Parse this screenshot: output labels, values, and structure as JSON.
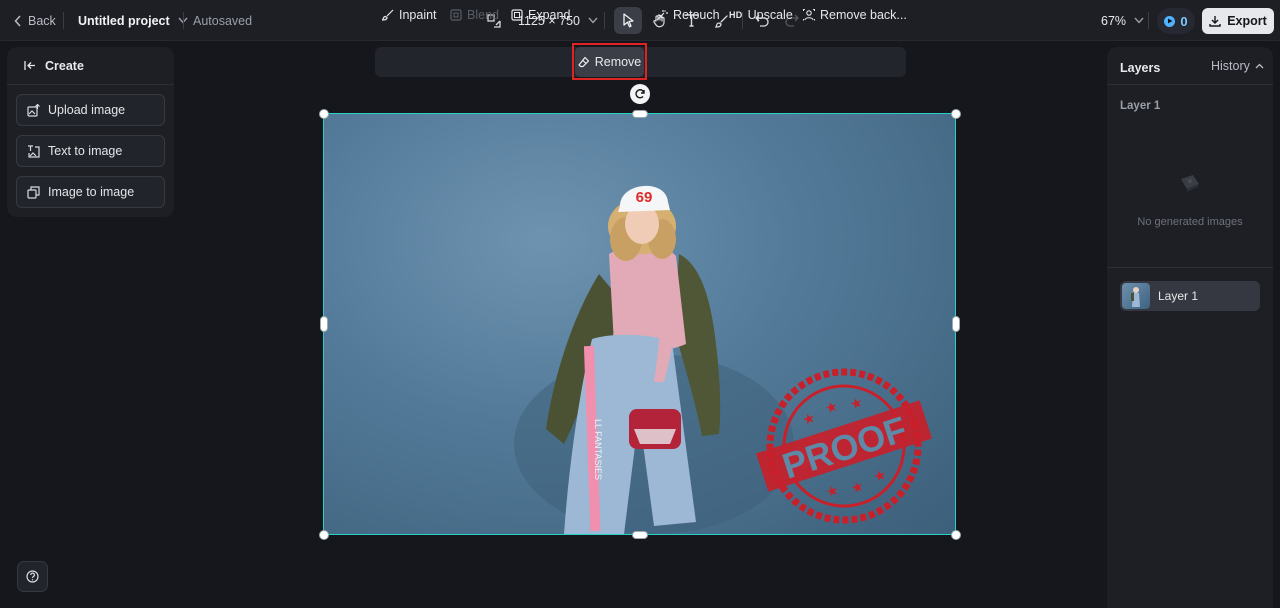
{
  "topbar": {
    "back_label": "Back",
    "project_title": "Untitled project",
    "autosave_status": "Autosaved",
    "canvas_size": "1125 × 750",
    "zoom": "67%",
    "credits": "0",
    "export_label": "Export"
  },
  "left_panel": {
    "title": "Create",
    "items": [
      {
        "label": "Upload image",
        "icon": "upload-image-icon"
      },
      {
        "label": "Text to image",
        "icon": "text-to-image-icon"
      },
      {
        "label": "Image to image",
        "icon": "image-to-image-icon"
      }
    ]
  },
  "image_toolbar": {
    "items": [
      {
        "label": "Inpaint",
        "icon": "brush-icon",
        "enabled": true
      },
      {
        "label": "Blend",
        "icon": "blend-icon",
        "enabled": false
      },
      {
        "label": "Expand",
        "icon": "expand-icon",
        "enabled": true
      },
      {
        "label": "Remove",
        "icon": "eraser-icon",
        "enabled": true,
        "highlighted": true
      },
      {
        "label": "Retouch",
        "icon": "magic-wand-icon",
        "enabled": true
      },
      {
        "label": "Upscale",
        "icon": "hd-icon",
        "enabled": true
      },
      {
        "label": "Remove back...",
        "icon": "remove-background-icon",
        "enabled": true
      }
    ]
  },
  "canvas": {
    "image_content": {
      "cap_number": "69",
      "stamp_text": "PROOF",
      "pants_text": "LL FANTASIES"
    },
    "selection_color": "#2ad0c6"
  },
  "right_panel": {
    "tab_layers": "Layers",
    "tab_history": "History",
    "section_title": "Layer 1",
    "empty_state": "No generated images",
    "layers": [
      {
        "name": "Layer 1"
      }
    ]
  },
  "colors": {
    "highlight_border": "#e02424",
    "accent": "#4fb3ff"
  }
}
